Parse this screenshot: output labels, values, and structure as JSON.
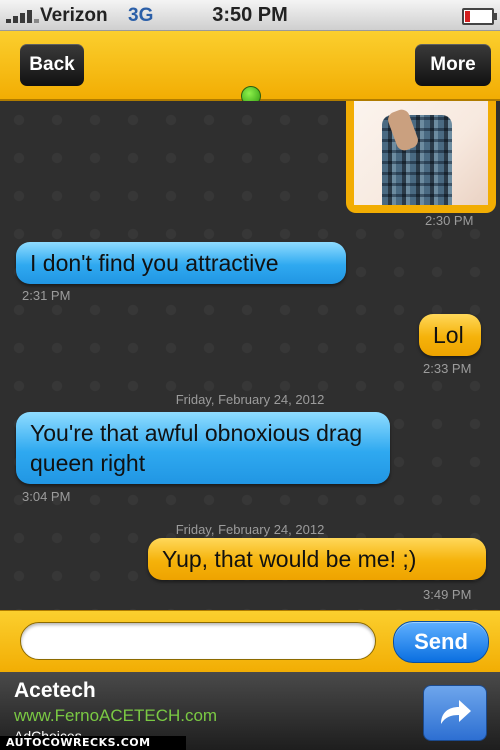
{
  "status_bar": {
    "carrier": "Verizon",
    "network": "3G",
    "time": "3:50 PM",
    "battery_level": 0.2,
    "battery_color": "#d32020"
  },
  "nav": {
    "back_label": "Back",
    "more_label": "More",
    "online_status_color": "#3fbf14"
  },
  "messages": [
    {
      "sender": "other",
      "type": "photo",
      "time": "2:30 PM"
    },
    {
      "sender": "them",
      "text": "I don't find you attractive",
      "time": "2:31 PM"
    },
    {
      "sender": "me",
      "text": "Lol",
      "time": "2:33 PM"
    },
    {
      "date_separator": "Friday, February 24, 2012"
    },
    {
      "sender": "them",
      "text": "You're that awful obnoxious drag queen right",
      "time": "3:04 PM"
    },
    {
      "date_separator": "Friday, February 24, 2012"
    },
    {
      "sender": "me",
      "text": "Yup, that would be me! ;)",
      "time": "3:49 PM"
    }
  ],
  "composer": {
    "value": "",
    "placeholder": "",
    "send_label": "Send"
  },
  "ad": {
    "title": "Acetech",
    "url": "www.FernoACETECH.com",
    "choices": "AdChoices"
  },
  "watermark": "AUTOCOWRECKS.COM",
  "colors": {
    "accent_orange": "#f5b20a",
    "bubble_blue": "#2fa9f0",
    "send_blue": "#0a6fe0"
  }
}
